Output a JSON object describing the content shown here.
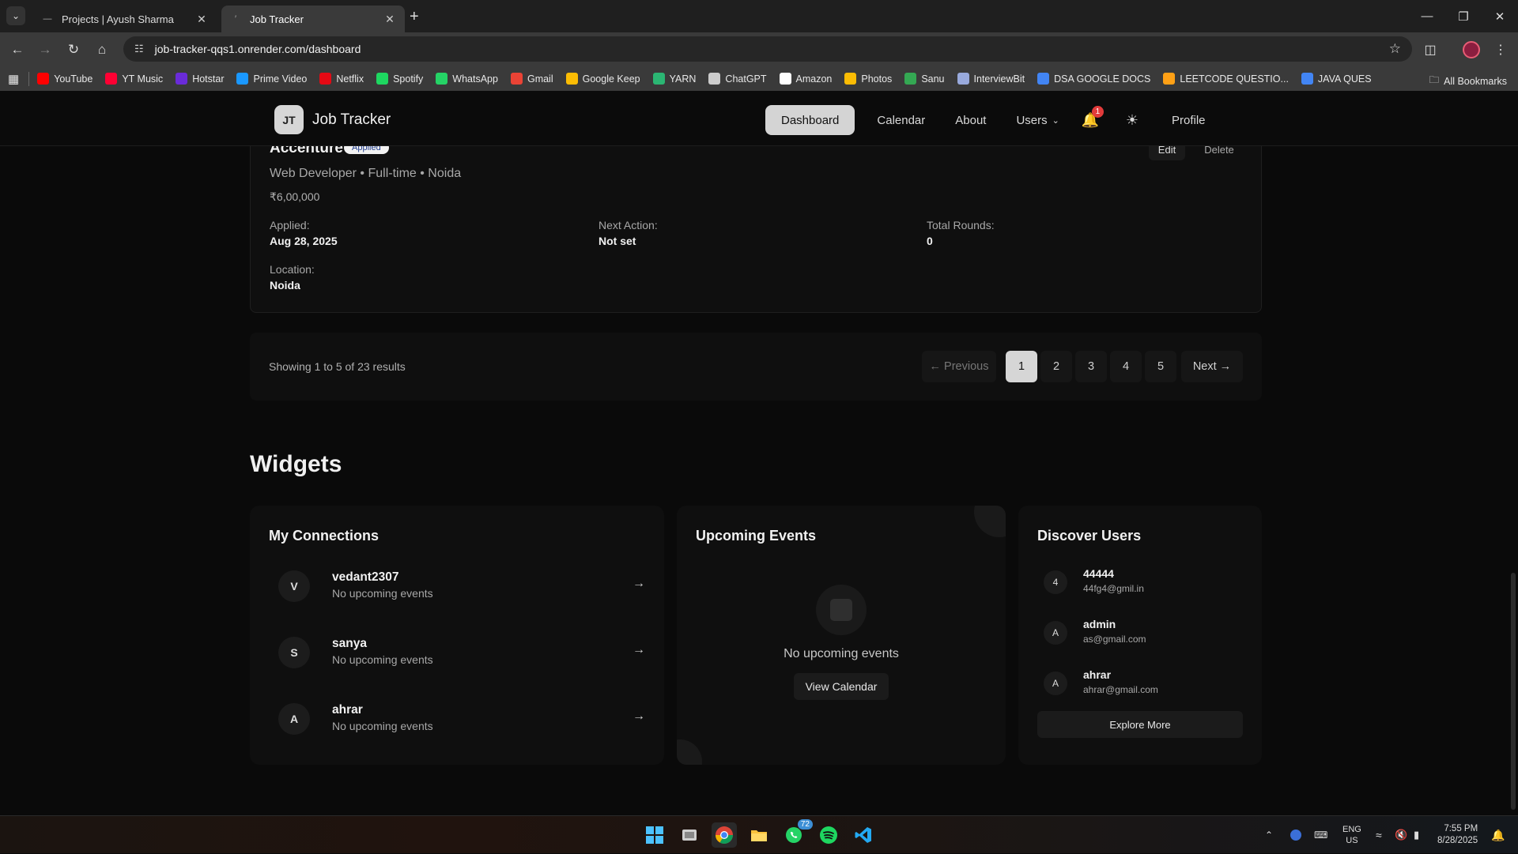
{
  "browser": {
    "tabs": [
      {
        "title": "Projects | Ayush Sharma",
        "active": false
      },
      {
        "title": "Job Tracker",
        "active": true
      }
    ],
    "url": "job-tracker-qqs1.onrender.com/dashboard",
    "bookmarks": [
      {
        "label": "YouTube",
        "color": "#ff0000"
      },
      {
        "label": "YT Music",
        "color": "#ff0033"
      },
      {
        "label": "Hotstar",
        "color": "#6a2bd9"
      },
      {
        "label": "Prime Video",
        "color": "#1a98ff"
      },
      {
        "label": "Netflix",
        "color": "#e50914"
      },
      {
        "label": "Spotify",
        "color": "#1ed760"
      },
      {
        "label": "WhatsApp",
        "color": "#25d366"
      },
      {
        "label": "Gmail",
        "color": "#ea4335"
      },
      {
        "label": "Google Keep",
        "color": "#fbbc04"
      },
      {
        "label": "YARN",
        "color": "#2bb673"
      },
      {
        "label": "ChatGPT",
        "color": "#cccccc"
      },
      {
        "label": "Amazon",
        "color": "#ffffff"
      },
      {
        "label": "Photos",
        "color": "#fbbc04"
      },
      {
        "label": "Sanu",
        "color": "#34a853"
      },
      {
        "label": "InterviewBit",
        "color": "#9ad"
      },
      {
        "label": "DSA GOOGLE DOCS",
        "color": "#4285f4"
      },
      {
        "label": "LEETCODE QUESTIO...",
        "color": "#ffa116"
      },
      {
        "label": "JAVA QUES",
        "color": "#4285f4"
      }
    ],
    "all_bookmarks": "All Bookmarks"
  },
  "app": {
    "logo_initials": "JT",
    "brand": "Job Tracker",
    "nav": {
      "dashboard": "Dashboard",
      "calendar": "Calendar",
      "about": "About",
      "users": "Users",
      "notifications": "1",
      "profile": "Profile"
    }
  },
  "job_card": {
    "company": "Accenture",
    "status": "Applied",
    "subtitle": "Web Developer • Full-time • Noida",
    "salary": "₹6,00,000",
    "edit": "Edit",
    "delete": "Delete",
    "fields": {
      "applied_label": "Applied:",
      "applied_value": "Aug 28, 2025",
      "next_label": "Next Action:",
      "next_value": "Not set",
      "rounds_label": "Total Rounds:",
      "rounds_value": "0",
      "location_label": "Location:",
      "location_value": "Noida"
    }
  },
  "pagination": {
    "info": "Showing 1 to 5 of 23 results",
    "previous": "← Previous",
    "pages": [
      "1",
      "2",
      "3",
      "4",
      "5"
    ],
    "current": "1",
    "next": "Next →"
  },
  "widgets": {
    "title": "Widgets",
    "connections": {
      "title": "My Connections",
      "items": [
        {
          "initial": "V",
          "name": "vedant2307",
          "sub": "No upcoming events"
        },
        {
          "initial": "S",
          "name": "sanya",
          "sub": "No upcoming events"
        },
        {
          "initial": "A",
          "name": "ahrar",
          "sub": "No upcoming events"
        }
      ],
      "arrow": "→"
    },
    "events": {
      "title": "Upcoming Events",
      "empty": "No upcoming events",
      "button": "View Calendar"
    },
    "discover": {
      "title": "Discover Users",
      "users": [
        {
          "initial": "4",
          "name": "44444",
          "email": "44fg4@gmil.in"
        },
        {
          "initial": "A",
          "name": "admin",
          "email": "as@gmail.com"
        },
        {
          "initial": "A",
          "name": "ahrar",
          "email": "ahrar@gmail.com"
        }
      ],
      "button": "Explore More"
    }
  },
  "taskbar": {
    "whatsapp_badge": "72",
    "lang_top": "ENG",
    "lang_bottom": "US",
    "time": "7:55 PM",
    "date": "8/28/2025"
  }
}
